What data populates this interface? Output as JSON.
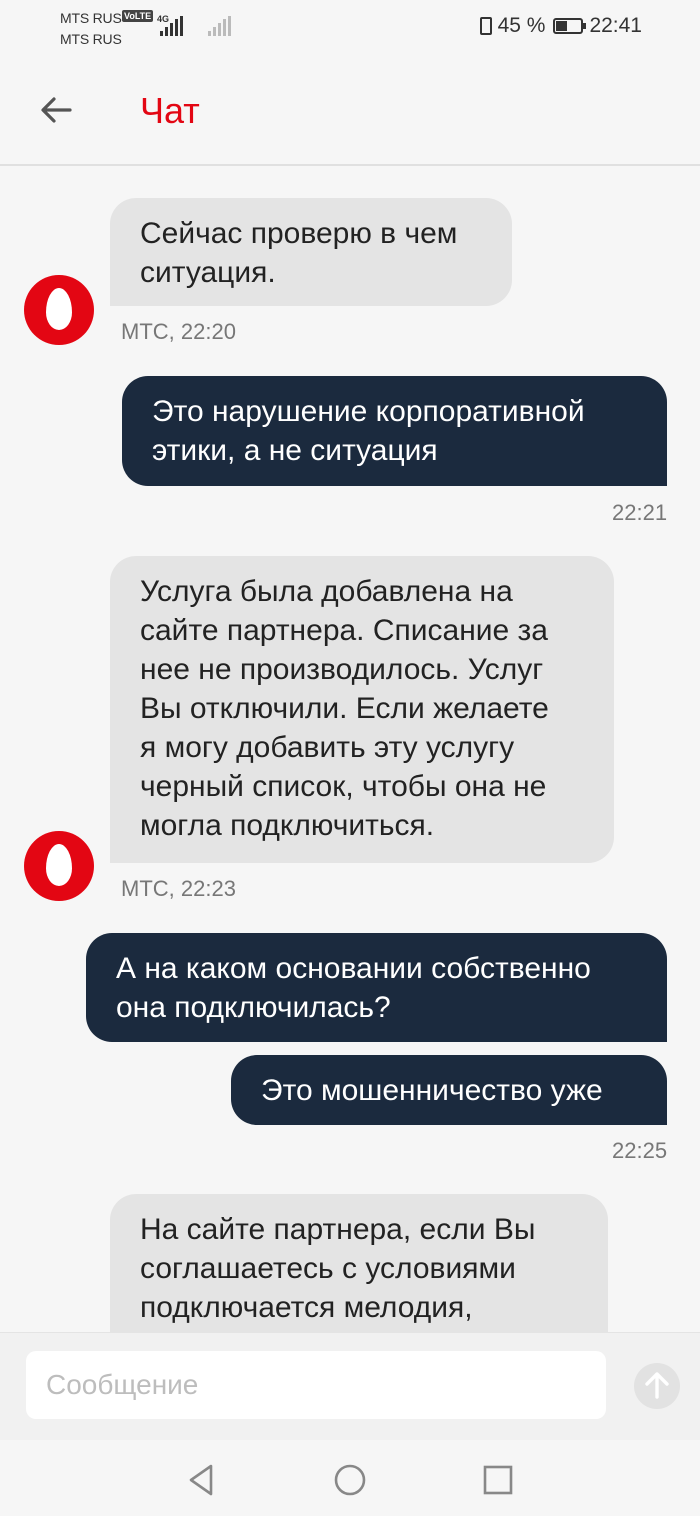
{
  "status_bar": {
    "carrier_1": "MTS RUS",
    "carrier_2": "MTS RUS",
    "volte": "VoLTE",
    "network": "4G",
    "battery_percent": "45 %",
    "battery_level": 0.45,
    "time": "22:41"
  },
  "header": {
    "title": "Чат",
    "back_icon": "arrow-left-icon"
  },
  "messages": [
    {
      "side": "in",
      "lines": [
        "Сейчас проверю в чем",
        "ситуация."
      ],
      "meta": "МТС, 22:20"
    },
    {
      "side": "out",
      "lines": [
        "Это нарушение корпоративной",
        "этики, а не ситуация"
      ],
      "meta": "22:21"
    },
    {
      "side": "in",
      "lines": [
        "Услуга была добавлена на",
        "сайте партнера. Списание за",
        "нее не производилось. Услуг",
        "Вы отключили. Если желаете",
        "я могу добавить эту услугу",
        "черный список, чтобы она не",
        "могла подключиться."
      ],
      "meta": "МТС, 22:23"
    },
    {
      "side": "out",
      "lines": [
        "А на каком основании собственно",
        "она подключилась?"
      ],
      "meta": ""
    },
    {
      "side": "out",
      "lines": [
        "Это мошенничество уже"
      ],
      "meta": "22:25"
    },
    {
      "side": "in",
      "lines": [
        "На сайте партнера, если Вы",
        "соглашаетесь с условиями",
        "подключается мелодия,"
      ],
      "meta": ""
    }
  ],
  "input": {
    "placeholder": "Сообщение",
    "value": ""
  },
  "icons": {
    "avatar": "mts-logo-icon",
    "send": "send-arrow-up-icon",
    "nav_back": "triangle-back-icon",
    "nav_home": "circle-home-icon",
    "nav_recents": "square-recents-icon"
  },
  "colors": {
    "accent": "#e30613",
    "outgoing_bubble": "#1b2a3e",
    "incoming_bubble": "#e4e4e4",
    "background": "#f6f6f6"
  }
}
